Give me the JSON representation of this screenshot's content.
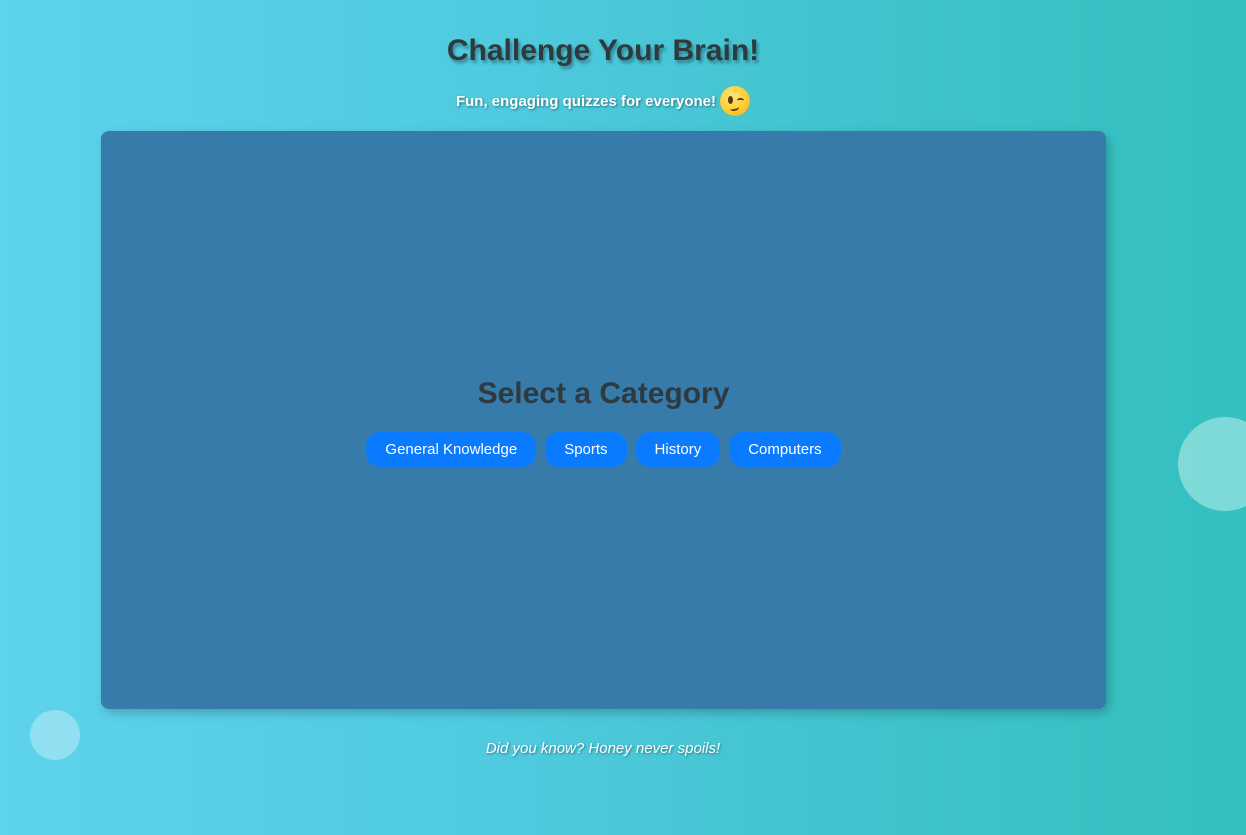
{
  "header": {
    "title": "Challenge Your Brain!",
    "subtitle": "Fun, engaging quizzes for everyone!",
    "subtitle_icon": "thinking-face-emoji"
  },
  "quiz": {
    "heading": "Select a Category",
    "categories": [
      {
        "label": "General Knowledge"
      },
      {
        "label": "Sports"
      },
      {
        "label": "History"
      },
      {
        "label": "Computers"
      }
    ]
  },
  "footer": {
    "fact": "Did you know? Honey never spoils!"
  },
  "colors": {
    "background_start": "#5dd3ec",
    "background_end": "#33c0bf",
    "panel": "#367ba9",
    "button": "#0a7bff",
    "heading_text": "#2e3a40"
  }
}
